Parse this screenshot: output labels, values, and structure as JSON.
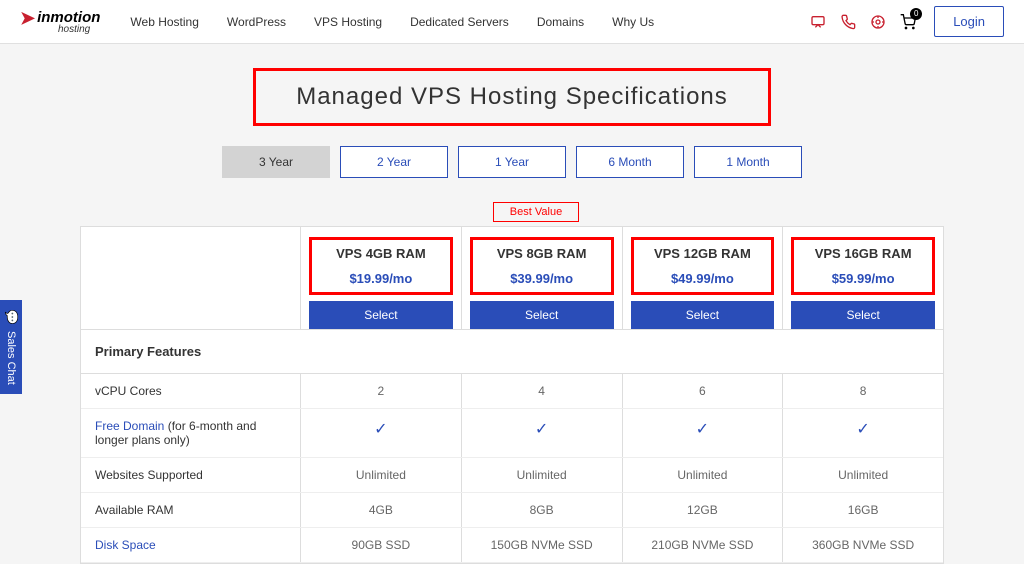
{
  "header": {
    "logo_main": "inmotion",
    "logo_sub": "hosting",
    "nav": [
      "Web Hosting",
      "WordPress",
      "VPS Hosting",
      "Dedicated Servers",
      "Domains",
      "Why Us"
    ],
    "cart_count": "0",
    "login": "Login"
  },
  "title": "Managed VPS Hosting Specifications",
  "terms": [
    "3  Year",
    "2  Year",
    "1  Year",
    "6  Month",
    "1  Month"
  ],
  "active_term": 0,
  "best_value": "Best Value",
  "plans": [
    {
      "name": "VPS 4GB RAM",
      "price": "$19.99/mo",
      "select": "Select"
    },
    {
      "name": "VPS 8GB RAM",
      "price": "$39.99/mo",
      "select": "Select"
    },
    {
      "name": "VPS 12GB RAM",
      "price": "$49.99/mo",
      "select": "Select"
    },
    {
      "name": "VPS 16GB RAM",
      "price": "$59.99/mo",
      "select": "Select"
    }
  ],
  "features_header": "Primary Features",
  "features": [
    {
      "label": "vCPU Cores",
      "link": false,
      "values": [
        "2",
        "4",
        "6",
        "8"
      ]
    },
    {
      "label": "Free Domain",
      "link": true,
      "suffix": " (for 6-month and longer plans only)",
      "values": [
        "check",
        "check",
        "check",
        "check"
      ]
    },
    {
      "label": "Websites Supported",
      "link": false,
      "values": [
        "Unlimited",
        "Unlimited",
        "Unlimited",
        "Unlimited"
      ]
    },
    {
      "label": "Available RAM",
      "link": false,
      "values": [
        "4GB",
        "8GB",
        "12GB",
        "16GB"
      ]
    },
    {
      "label": "Disk Space",
      "link": true,
      "values": [
        "90GB SSD",
        "150GB NVMe SSD",
        "210GB NVMe SSD",
        "360GB NVMe SSD"
      ]
    }
  ],
  "sales_chat": "Sales Chat"
}
